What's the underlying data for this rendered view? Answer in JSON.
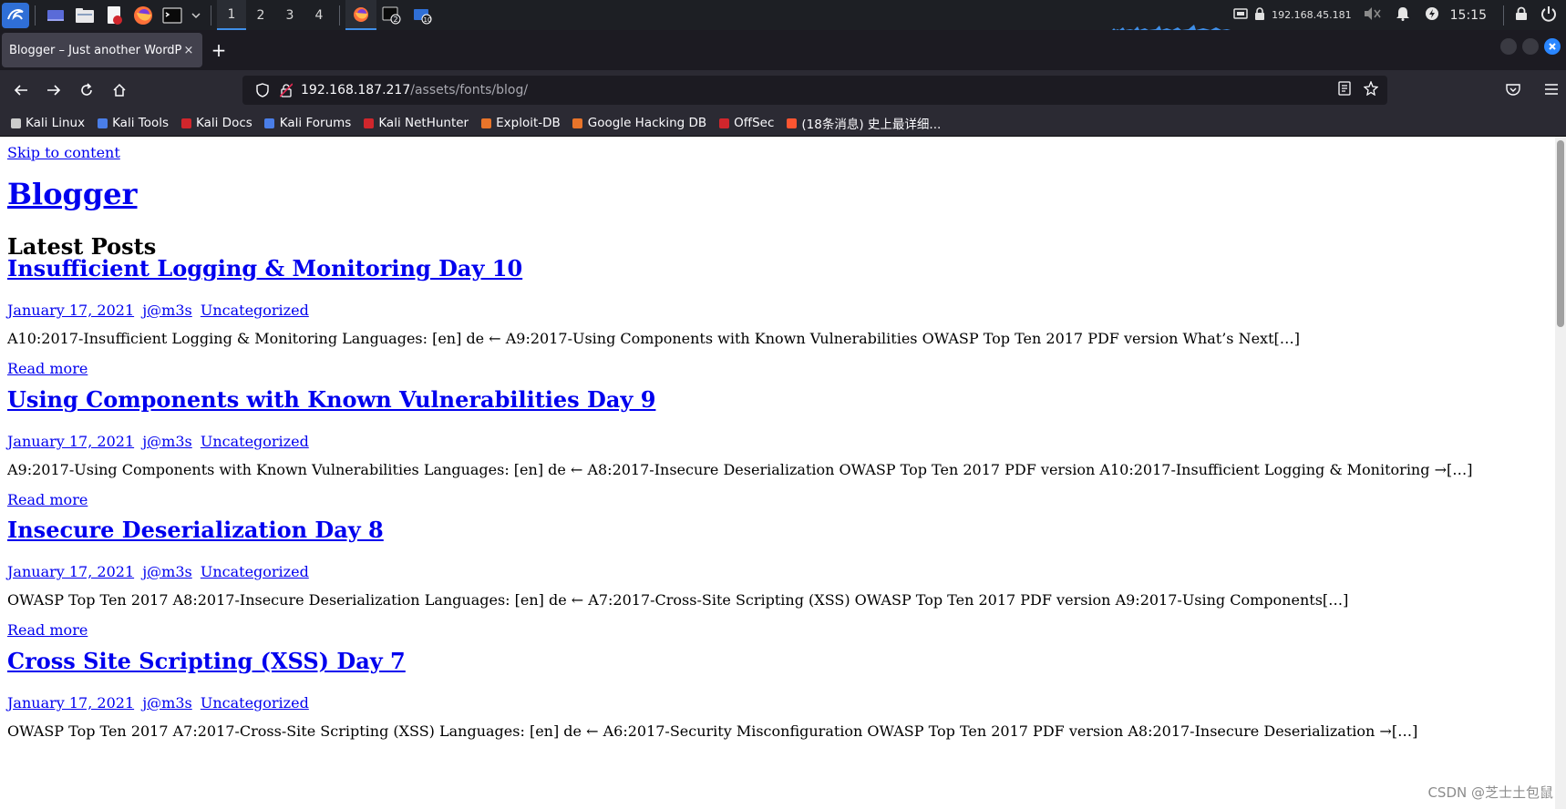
{
  "panel": {
    "workspaces": [
      "1",
      "2",
      "3",
      "4"
    ],
    "active_workspace": 0,
    "ip": "192.168.45.181",
    "clock": "15:15"
  },
  "browser": {
    "tab_title": "Blogger – Just another WordPress site",
    "tab_close": "×",
    "new_tab": "+",
    "url_host": "192.168.187.217",
    "url_path": "/assets/fonts/blog/",
    "bookmarks": [
      {
        "label": "Kali Linux",
        "icon": "kali-dragon-icon",
        "color": "#cccccc"
      },
      {
        "label": "Kali Tools",
        "icon": "kali-tools-icon",
        "color": "#4a7ee8"
      },
      {
        "label": "Kali Docs",
        "icon": "kali-docs-icon",
        "color": "#d0262c"
      },
      {
        "label": "Kali Forums",
        "icon": "kali-forums-icon",
        "color": "#4a7ee8"
      },
      {
        "label": "Kali NetHunter",
        "icon": "nethunter-icon",
        "color": "#d0262c"
      },
      {
        "label": "Exploit-DB",
        "icon": "exploit-db-icon",
        "color": "#e8742a"
      },
      {
        "label": "Google Hacking DB",
        "icon": "ghdb-icon",
        "color": "#e8742a"
      },
      {
        "label": "OffSec",
        "icon": "offsec-icon",
        "color": "#d0262c"
      },
      {
        "label": "(18条消息) 史上最详细...",
        "icon": "csdn-icon",
        "color": "#fc5531"
      }
    ]
  },
  "page": {
    "skip_link": "Skip to content",
    "site_title": "Blogger",
    "section_heading": "Latest Posts",
    "read_more": "Read more",
    "posts": [
      {
        "title": "Insufficient Logging & Monitoring Day 10",
        "date": "January 17, 2021",
        "author": "j@m3s",
        "category": "Uncategorized",
        "excerpt": "A10:2017-Insufficient Logging & Monitoring Languages: [en] de ← A9:2017-Using Components with Known Vulnerabilities OWASP Top Ten 2017 PDF version What’s Next[…]"
      },
      {
        "title": "Using Components with Known Vulnerabilities Day 9",
        "date": "January 17, 2021",
        "author": "j@m3s",
        "category": "Uncategorized",
        "excerpt": "A9:2017-Using Components with Known Vulnerabilities Languages: [en] de ← A8:2017-Insecure Deserialization OWASP Top Ten 2017 PDF version A10:2017-Insufficient Logging & Monitoring →[…]"
      },
      {
        "title": "Insecure Deserialization Day 8",
        "date": "January 17, 2021",
        "author": "j@m3s",
        "category": "Uncategorized",
        "excerpt": "OWASP Top Ten 2017 A8:2017-Insecure Deserialization Languages: [en] de ← A7:2017-Cross-Site Scripting (XSS) OWASP Top Ten 2017 PDF version A9:2017-Using Components[…]"
      },
      {
        "title": "Cross Site Scripting (XSS) Day 7",
        "date": "January 17, 2021",
        "author": "j@m3s",
        "category": "Uncategorized",
        "excerpt": "OWASP Top Ten 2017 A7:2017-Cross-Site Scripting (XSS) Languages: [en] de ← A6:2017-Security Misconfiguration OWASP Top Ten 2017 PDF version A8:2017-Insecure Deserialization →[…]"
      }
    ]
  },
  "watermark": "CSDN @芝士土包鼠",
  "colors": {
    "link": "#0000ee",
    "accent": "#3f8fe8",
    "panel_bg": "#1d1f24",
    "toolbar_bg": "#2b2a33"
  }
}
